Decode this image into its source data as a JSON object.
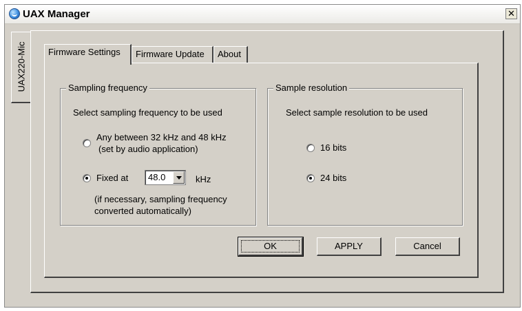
{
  "window": {
    "title": "UAX Manager",
    "close_glyph": "✕"
  },
  "device_tab": {
    "label": "UAX220-Mic"
  },
  "tabs": [
    {
      "label": "Firmware Settings",
      "active": true
    },
    {
      "label": "Firmware Update",
      "active": false
    },
    {
      "label": "About",
      "active": false
    }
  ],
  "sampling": {
    "legend": "Sampling frequency",
    "instruction": "Select sampling frequency to be used",
    "option_any_line1": "Any between 32 kHz and 48 kHz",
    "option_any_line2": "(set by audio application)",
    "option_fixed": "Fixed at",
    "fixed_value": "48.0",
    "unit": "kHz",
    "note_line1": "(if necessary, sampling frequency",
    "note_line2": "converted automatically)",
    "selected": "fixed"
  },
  "resolution": {
    "legend": "Sample resolution",
    "instruction": "Select sample resolution to be used",
    "option_16": "16 bits",
    "option_24": "24 bits",
    "selected": "24 bits"
  },
  "buttons": {
    "ok": "OK",
    "apply": "APPLY",
    "cancel": "Cancel"
  },
  "icons": {
    "app": "uax-manager-app-icon",
    "close": "close-icon",
    "dropdown": "chevron-down-icon"
  }
}
